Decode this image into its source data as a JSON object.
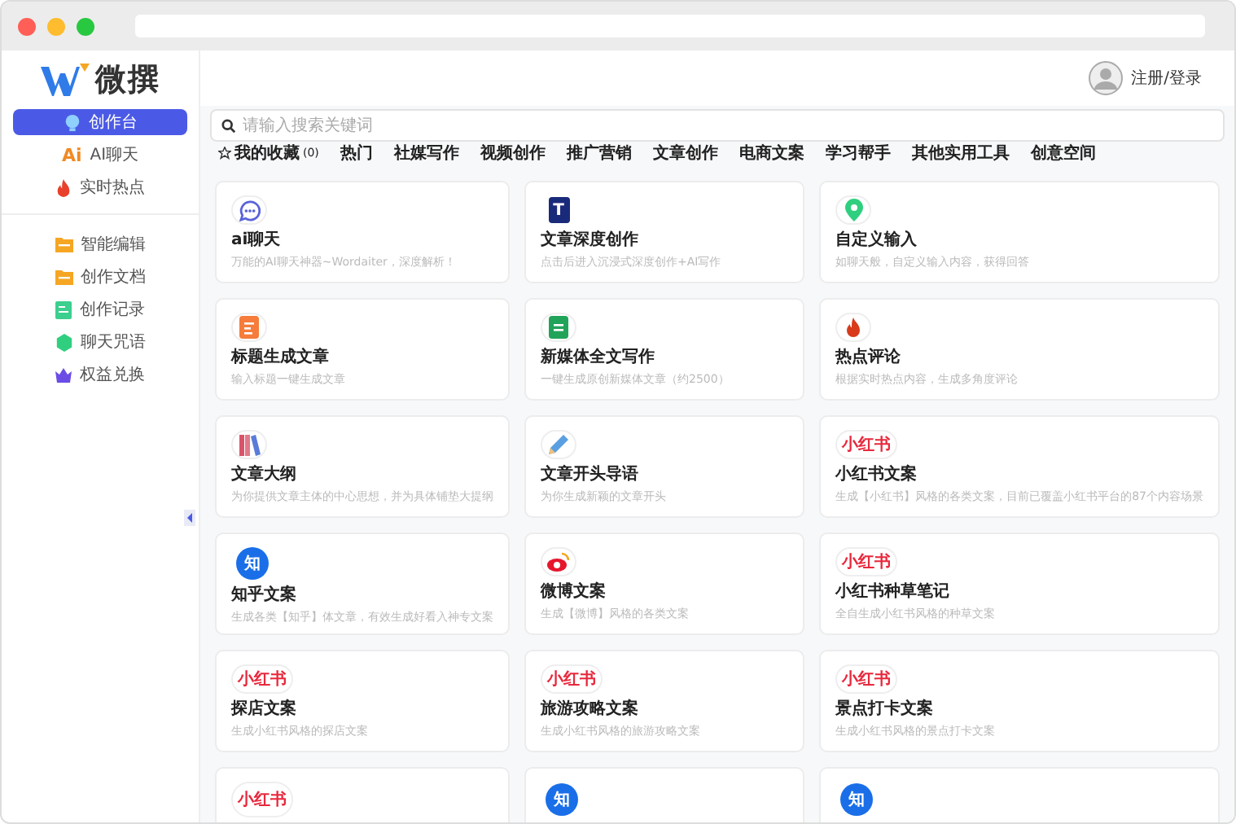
{
  "logo": {
    "text": "微撰"
  },
  "sidebar": {
    "groups": [
      {
        "items": [
          {
            "label": "创作台",
            "kind": "bulb",
            "selected": true
          },
          {
            "label": "AI聊天",
            "kind": "ai",
            "icon_text": "Ai",
            "selected": false
          },
          {
            "label": "实时热点",
            "kind": "fire",
            "selected": false
          }
        ]
      },
      {
        "items": [
          {
            "label": "智能编辑",
            "kind": "folder",
            "selected": false
          },
          {
            "label": "创作文档",
            "kind": "folder",
            "selected": false
          },
          {
            "label": "创作记录",
            "kind": "record",
            "selected": false
          },
          {
            "label": "聊天咒语",
            "kind": "hexagon",
            "selected": false
          },
          {
            "label": "权益兑换",
            "kind": "crown",
            "selected": false
          }
        ]
      }
    ]
  },
  "header": {
    "login": "注册/登录"
  },
  "search": {
    "placeholder": "请输入搜索关键词"
  },
  "tabs": [
    {
      "label": "我的收藏",
      "count": "(0)",
      "kind": "favorite",
      "selected": false
    },
    {
      "label": "热门",
      "kind": "plain",
      "selected": false
    },
    {
      "label": "社媒写作",
      "kind": "plain",
      "selected": false
    },
    {
      "label": "视频创作",
      "kind": "plain",
      "selected": false
    },
    {
      "label": "推广营销",
      "kind": "plain",
      "selected": false
    },
    {
      "label": "文章创作",
      "kind": "plain",
      "selected": false
    },
    {
      "label": "电商文案",
      "kind": "plain",
      "selected": false
    },
    {
      "label": "学习帮手",
      "kind": "plain",
      "selected": false
    },
    {
      "label": "其他实用工具",
      "kind": "plain",
      "selected": false
    },
    {
      "label": "创意空间",
      "kind": "plain",
      "selected": false
    }
  ],
  "cards": [
    {
      "kind": "chat",
      "title": "ai聊天",
      "description": "万能的AI聊天神器~Wordaiter，深度解析！"
    },
    {
      "kind": "doc",
      "icon_text": "T",
      "title": "文章深度创作",
      "description": "点击后进入沉浸式深度创作+AI写作"
    },
    {
      "kind": "pin",
      "title": "自定义输入",
      "description": "如聊天般，自定义输入内容，获得回答"
    },
    {
      "kind": "list",
      "title": "标题生成文章",
      "description": "输入标题一键生成文章"
    },
    {
      "kind": "sheet",
      "title": "新媒体全文写作",
      "description": "一键生成原创新媒体文章（约2500）"
    },
    {
      "kind": "fire",
      "title": "热点评论",
      "description": "根据实时热点内容，生成多角度评论"
    },
    {
      "kind": "books",
      "title": "文章大纲",
      "description": "为你提供文章主体的中心思想，并为具体铺垫大提纲"
    },
    {
      "kind": "pencil",
      "title": "文章开头导语",
      "description": "为你生成新颖的文章开头"
    },
    {
      "kind": "xhs",
      "icon_text": "小红书",
      "title": "小红书文案",
      "description": "生成【小红书】风格的各类文案，目前已覆盖小红书平台的87个内容场景"
    },
    {
      "kind": "zhihu",
      "icon_text": "知",
      "title": "知乎文案",
      "description": "生成各类【知乎】体文章，有效生成好看入神专文案"
    },
    {
      "kind": "weibo",
      "title": "微博文案",
      "description": "生成【微博】风格的各类文案"
    },
    {
      "kind": "xhs",
      "icon_text": "小红书",
      "title": "小红书种草笔记",
      "description": "全自生成小红书风格的种草文案"
    },
    {
      "kind": "xhs",
      "icon_text": "小红书",
      "title": "探店文案",
      "description": "生成小红书风格的探店文案"
    },
    {
      "kind": "xhs",
      "icon_text": "小红书",
      "title": "旅游攻略文案",
      "description": "生成小红书风格的旅游攻略文案"
    },
    {
      "kind": "xhs",
      "icon_text": "小红书",
      "title": "景点打卡文案",
      "description": "生成小红书风格的景点打卡文案"
    },
    {
      "kind": "xhs",
      "icon_text": "小红书"
    },
    {
      "kind": "zhihu",
      "icon_text": "知"
    },
    {
      "kind": "zhihu",
      "icon_text": "知"
    }
  ]
}
